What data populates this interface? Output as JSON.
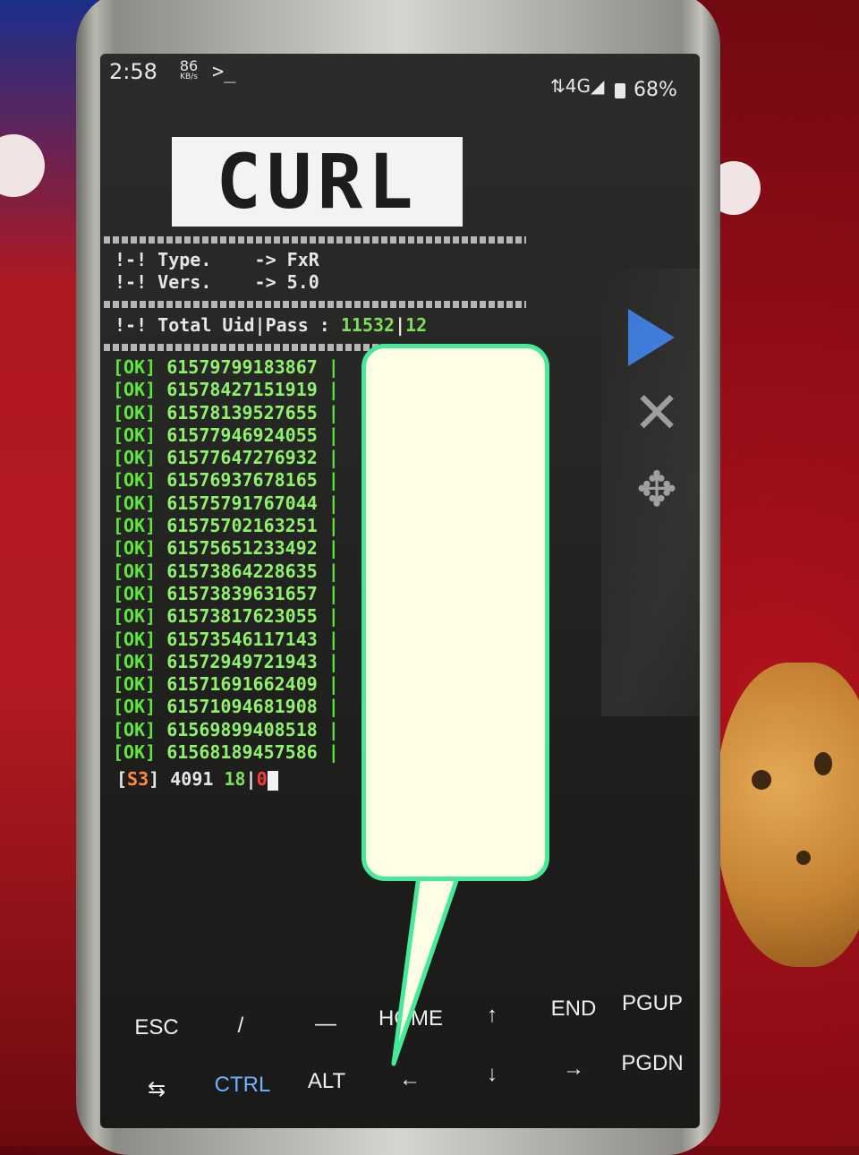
{
  "status_bar": {
    "time": "2:58",
    "net_speed_value": "86",
    "net_speed_unit": "KB/s",
    "terminal_icon_glyph": ">_",
    "signal": "4G",
    "battery": "68%"
  },
  "terminal": {
    "logo": "CURL",
    "type_line": "!-! Type.    -> FxR",
    "vers_line": "!-! Vers.    -> 5.0",
    "total_label": "!-! Total Uid|Pass : ",
    "total_ok": "11532",
    "total_sep": "|",
    "total_cp": "12",
    "ok_tag": "[OK]",
    "results": [
      "61579799183867",
      "61578427151919",
      "61578139527655",
      "61577946924055",
      "61577647276932",
      "61576937678165",
      "61575791767044",
      "61575702163251",
      "61575651233492",
      "61573864228635",
      "61573839631657",
      "61573817623055",
      "61573546117143",
      "61572949721943",
      "61571691662409",
      "61571094681908",
      "61569899408518",
      "61568189457586"
    ],
    "status_line": {
      "open": "[",
      "tag": "S3",
      "close": "]",
      "count": "4091",
      "ok": "18",
      "sep": "|",
      "err": "0"
    }
  },
  "extra_keys": {
    "row1": [
      "ESC",
      "/",
      "—",
      "HOME",
      "↑",
      "END",
      "PGUP"
    ],
    "row2": [
      "⇆",
      "CTRL",
      "ALT",
      "←",
      "↓",
      "→",
      "PGDN"
    ]
  },
  "colors": {
    "ok_green": "#5fe63a",
    "ctrl_blue": "#6fb2ff",
    "callout_border": "#47ea98",
    "play_blue": "#3a78d8"
  }
}
